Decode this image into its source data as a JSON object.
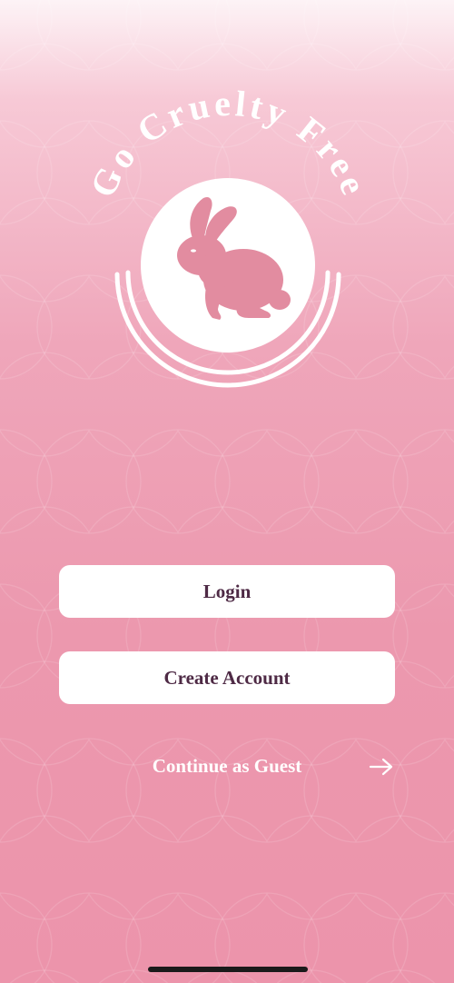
{
  "brand": {
    "logo_text": "Go Cruelty Free"
  },
  "actions": {
    "login_label": "Login",
    "create_account_label": "Create Account",
    "guest_label": "Continue as Guest"
  },
  "icons": {
    "logo": "rabbit-icon",
    "guest_arrow": "arrow-right-icon"
  },
  "colors": {
    "background_top": "#fdf3f6",
    "background_bottom": "#ec94ab",
    "button_bg": "#ffffff",
    "button_text": "#4e2a45",
    "rabbit": "#e28ca0"
  }
}
